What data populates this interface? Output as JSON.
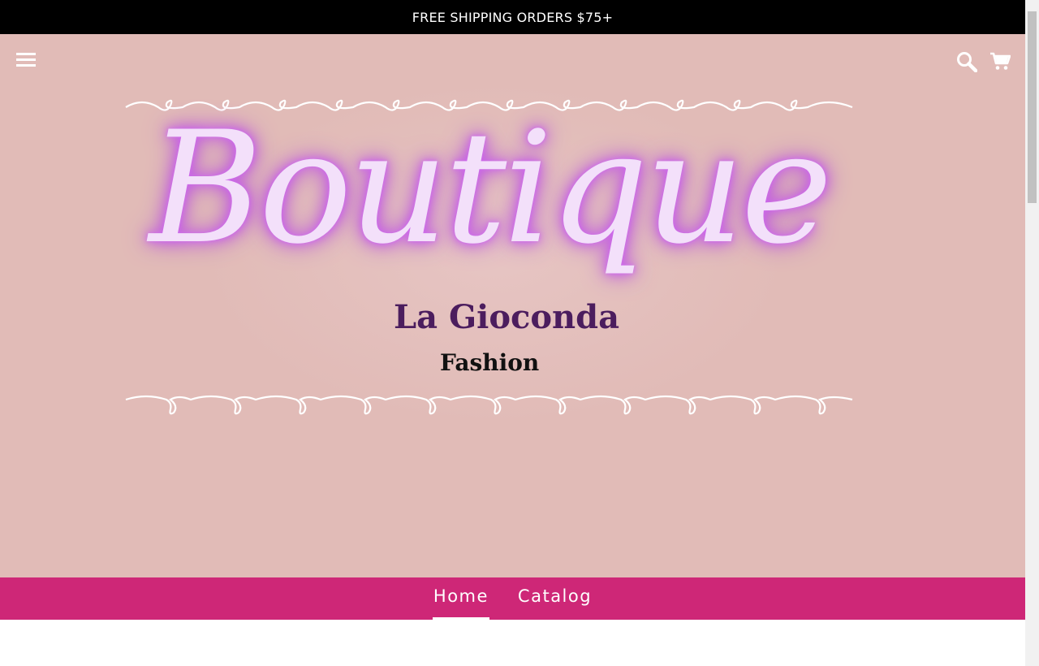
{
  "announcement": {
    "text": "FREE SHIPPING ORDERS $75+"
  },
  "header": {
    "menu_icon": "hamburger-menu-icon",
    "search_icon": "search-icon",
    "cart_icon": "cart-icon"
  },
  "logo": {
    "script_text": "Boutique",
    "name": "La Gioconda",
    "subtitle": "Fashion"
  },
  "nav": {
    "items": [
      {
        "label": "Home",
        "active": true
      },
      {
        "label": "Catalog",
        "active": false
      }
    ]
  },
  "colors": {
    "announcement_bg": "#000000",
    "hero_bg": "#e1bbb7",
    "nav_bg": "#ce2777",
    "logo_glow": "#c55ae6",
    "logo_name": "#4b1d5e"
  }
}
